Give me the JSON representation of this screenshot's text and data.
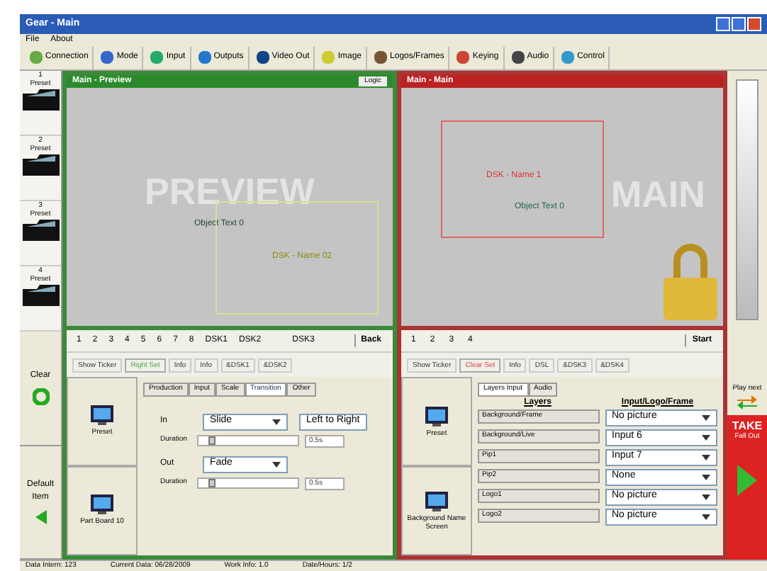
{
  "window": {
    "title": "Gear - Main"
  },
  "menu": [
    "File",
    "About"
  ],
  "toolbar": [
    "Connection",
    "Mode",
    "Input",
    "Outputs",
    "Video Out",
    "Image",
    "Logos/Frames",
    "Keying",
    "Audio",
    "Control"
  ],
  "presets": [
    "1\nPreset",
    "2\nPreset",
    "3\nPreset",
    "4\nPreset"
  ],
  "left_buttons": [
    {
      "label": "Clear",
      "kind": "clear"
    },
    {
      "label": "Default Item",
      "kind": "back"
    }
  ],
  "preview": {
    "title": "Main - Preview",
    "button": "Logic",
    "watermark": "PREVIEW",
    "object_label": "Object Text 0",
    "box_label": "DSK - Name 02"
  },
  "main": {
    "title": "Main - Main",
    "watermark": "MAIN",
    "box_label": "DSK - Name 1",
    "object_label": "Object Text 0"
  },
  "preview_keys": [
    "1",
    "2",
    "3",
    "4",
    "5",
    "6",
    "7",
    "8",
    "DSK1",
    "DSK2",
    "DSK3"
  ],
  "preview_back": "Back",
  "main_keys": [
    "1",
    "2",
    "3",
    "4"
  ],
  "main_start": "Start",
  "preview_modes": [
    {
      "label": "Show Ticker",
      "selected": false
    },
    {
      "label": "Right Set",
      "selected": true
    },
    {
      "label": "Info",
      "selected": false
    },
    {
      "label": "Info",
      "selected": false
    },
    {
      "label": "&DSK1",
      "selected": false
    },
    {
      "label": "&DSK2",
      "selected": false
    }
  ],
  "main_modes": [
    {
      "label": "Show Ticker",
      "selected": false
    },
    {
      "label": "Clear Set",
      "selected": true
    },
    {
      "label": "Info",
      "selected": false
    },
    {
      "label": "DSL",
      "selected": false
    },
    {
      "label": "&DSK3",
      "selected": false
    },
    {
      "label": "&DSK4",
      "selected": false
    }
  ],
  "left_items": [
    "Preset",
    "Part Board 10"
  ],
  "tabs": [
    {
      "label": "Production",
      "selected": false
    },
    {
      "label": "Input",
      "selected": false
    },
    {
      "label": "Scale",
      "selected": false
    },
    {
      "label": "Transition",
      "selected": true
    },
    {
      "label": "Other",
      "selected": false
    }
  ],
  "transition": [
    {
      "label": "In",
      "effect": "Slide",
      "direction": "Left to Right",
      "duration_label": "Duration",
      "level": 0.1,
      "value": "0.5s"
    },
    {
      "label": "Out",
      "effect": "Fade",
      "duration_label": "Duration",
      "level": 0.1,
      "value": "0.5s"
    }
  ],
  "right_items": [
    "Preset",
    "Background Name Screen"
  ],
  "right_tabs": [
    {
      "label": "Layers Input",
      "selected": true
    },
    {
      "label": "Audio",
      "selected": false
    }
  ],
  "layers": {
    "columns": [
      "Layers",
      "Input/Logo/Frame"
    ],
    "rows": [
      {
        "layer": "Background/Frame",
        "value": "No picture"
      },
      {
        "layer": "Background/Live",
        "value": "Input 6"
      },
      {
        "layer": "Pip1",
        "value": "Input 7"
      },
      {
        "layer": "Pip2",
        "value": "None"
      },
      {
        "layer": "Logo1",
        "value": "No picture"
      },
      {
        "layer": "Logo2",
        "value": "No picture"
      }
    ]
  },
  "play_next": "Play next",
  "take": {
    "label": "TAKE",
    "sub": "Fall Out"
  },
  "status_bar": [
    "Data Intern: 123",
    "Current Data: 06/28/2009",
    "Work Info: 1.0",
    "Date/Hours: 1/2"
  ]
}
